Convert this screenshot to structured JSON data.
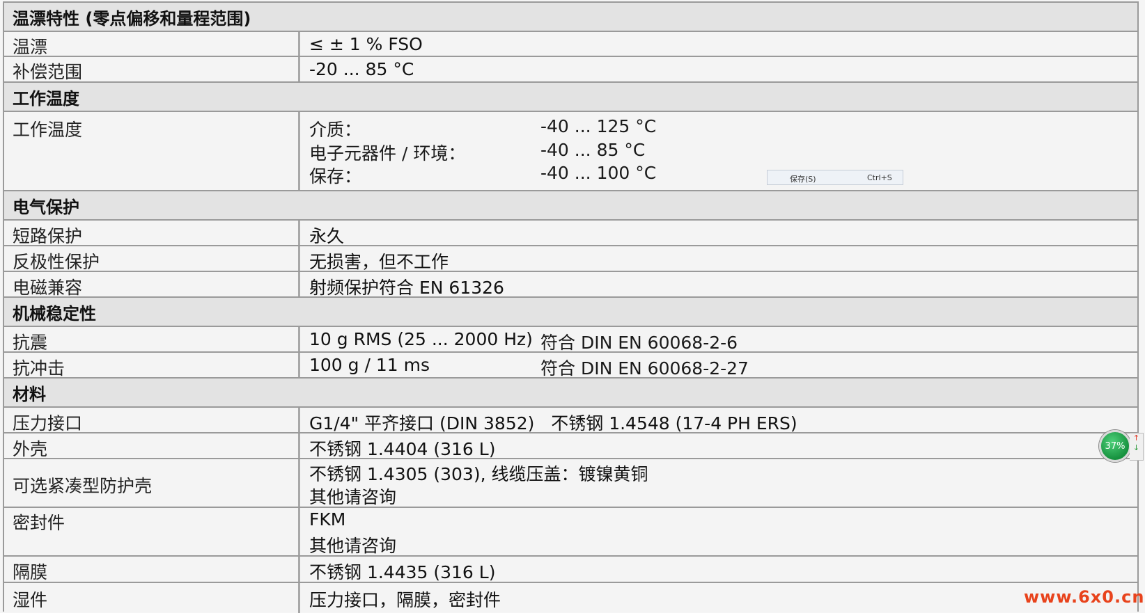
{
  "sections": {
    "temp_drift": {
      "title": "温漂特性 (零点偏移和量程范围)",
      "rows": [
        {
          "label": "温漂",
          "value": "≤ ± 1 % FSO"
        },
        {
          "label": "补偿范围",
          "value": "-20 ... 85 °C"
        }
      ]
    },
    "operating_temp": {
      "title": "工作温度",
      "label": "工作温度",
      "items": [
        {
          "name": "介质：",
          "value": "-40 ... 125 °C"
        },
        {
          "name": "电子元器件 / 环境：",
          "value": "-40 ... 85 °C"
        },
        {
          "name": "保存：",
          "value": "-40 ... 100 °C"
        }
      ]
    },
    "electrical": {
      "title": "电气保护",
      "rows": [
        {
          "label": "短路保护",
          "value": "永久"
        },
        {
          "label": "反极性保护",
          "value": "无损害，但不工作"
        },
        {
          "label": "电磁兼容",
          "value": "射频保护符合 EN 61326"
        }
      ]
    },
    "mechanical": {
      "title": "机械稳定性",
      "rows": [
        {
          "label": "抗震",
          "value": "10 g RMS (25 ... 2000 Hz)",
          "standard": "符合 DIN EN 60068-2-6"
        },
        {
          "label": "抗冲击",
          "value": "100 g / 11 ms",
          "standard": "符合 DIN EN 60068-2-27"
        }
      ]
    },
    "materials": {
      "title": "材料",
      "rows": [
        {
          "label": "压力接口",
          "value": "G1/4\" 平齐接口 (DIN 3852)   不锈钢 1.4548 (17-4 PH ERS)"
        },
        {
          "label": "外壳",
          "value": "不锈钢 1.4404 (316 L)"
        },
        {
          "label": "可选紧凑型防护壳",
          "value": "不锈钢 1.4305 (303), 线缆压盖：镀镍黄铜",
          "value2": "其他请咨询"
        },
        {
          "label": "密封件",
          "value": "FKM",
          "value2": "其他请咨询"
        },
        {
          "label": "隔膜",
          "value": "不锈钢 1.4435 (316 L)"
        },
        {
          "label": "湿件",
          "value": "压力接口，隔膜，密封件"
        }
      ]
    }
  },
  "context_menu": {
    "item": "保存(S)",
    "shortcut": "Ctrl+S"
  },
  "widget": {
    "percent": "37%",
    "up": "↑",
    "down": "↓"
  },
  "watermark": "www.6x0.cn"
}
